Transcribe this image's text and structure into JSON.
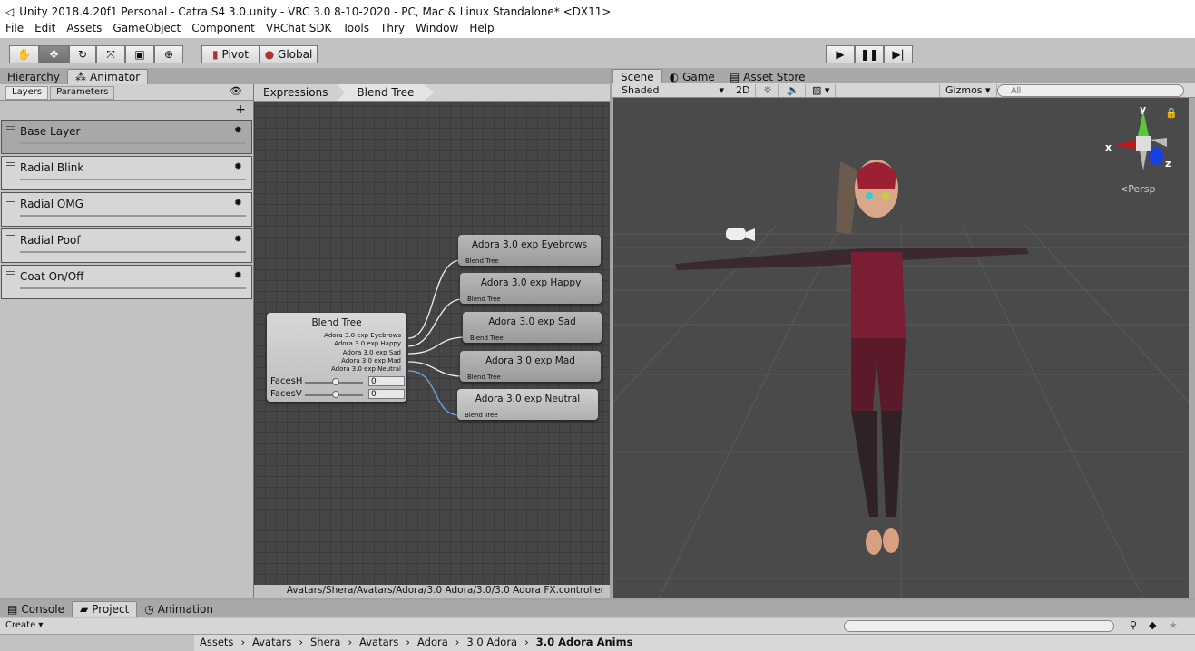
{
  "window": {
    "title": "Unity 2018.4.20f1 Personal - Catra S4 3.0.unity - VRC 3.0 8-10-2020 - PC, Mac & Linux Standalone* <DX11>"
  },
  "menu": [
    "File",
    "Edit",
    "Assets",
    "GameObject",
    "Component",
    "VRChat SDK",
    "Tools",
    "Thry",
    "Window",
    "Help"
  ],
  "toolbar": {
    "tools": [
      "hand-tool",
      "move-tool",
      "rotate-tool",
      "scale-tool",
      "rect-tool",
      "transform-tool"
    ],
    "pivot": "Pivot",
    "global": "Global"
  },
  "left_tabs": [
    "Hierarchy",
    "Animator"
  ],
  "animator": {
    "subtabs": [
      "Layers",
      "Parameters"
    ],
    "layers": [
      "Base Layer",
      "Radial Blink",
      "Radial OMG",
      "Radial Poof",
      "Coat On/Off"
    ],
    "breadcrumb": [
      "Expressions",
      "Blend Tree"
    ],
    "blend_tree": {
      "title": "Blend Tree",
      "outputs": [
        "Adora 3.0 exp Eyebrows",
        "Adora 3.0 exp Happy",
        "Adora 3.0 exp Sad",
        "Adora 3.0 exp Mad",
        "Adora 3.0 exp Neutral"
      ],
      "params": [
        {
          "name": "FacesH",
          "value": "0"
        },
        {
          "name": "FacesV",
          "value": "0"
        }
      ]
    },
    "child_nodes": [
      {
        "title": "Adora 3.0 exp Eyebrows",
        "sub": "Blend Tree"
      },
      {
        "title": "Adora 3.0 exp Happy",
        "sub": "Blend Tree"
      },
      {
        "title": "Adora 3.0 exp Sad",
        "sub": "Blend Tree"
      },
      {
        "title": "Adora 3.0 exp Mad",
        "sub": "Blend Tree"
      },
      {
        "title": "Adora 3.0 exp Neutral",
        "sub": "Blend Tree"
      }
    ],
    "controller_path": "Avatars/Shera/Avatars/Adora/3.0 Adora/3.0/3.0 Adora FX.controller"
  },
  "scene": {
    "tabs": [
      "Scene",
      "Game",
      "Asset Store"
    ],
    "shading": "Shaded",
    "mode2d": "2D",
    "gizmos": "Gizmos",
    "search_placeholder": "All",
    "persp": "Persp",
    "axes": {
      "x": "x",
      "y": "y",
      "z": "z"
    }
  },
  "bottom": {
    "tabs": [
      "Console",
      "Project",
      "Animation"
    ],
    "create": "Create",
    "breadcrumb": [
      "Assets",
      "Avatars",
      "Shera",
      "Avatars",
      "Adora",
      "3.0 Adora",
      "3.0 Adora Anims"
    ]
  }
}
